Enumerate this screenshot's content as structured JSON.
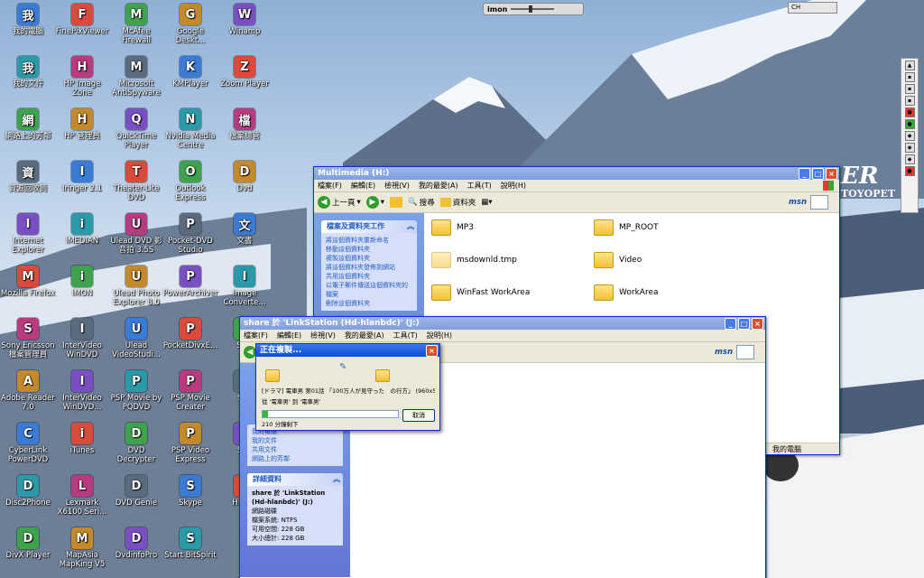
{
  "desktop_icons": [
    [
      "我的電腦",
      "FinePixViewer",
      "McAfee Firewall",
      "Google Deskt...",
      "Winamp"
    ],
    [
      "我的文件",
      "HP Image Zone",
      "Microsoft AntiSpyware",
      "KMPlayer",
      "Zoom Player"
    ],
    [
      "網路上的芳鄰",
      "HP 管理員",
      "QuickTime Player",
      "Nvidia Media Centre",
      "檔案總管"
    ],
    [
      "資源回收筒",
      "Iringer 2.1",
      "Theater-Lite DVD",
      "Outlook Express",
      "Dvd"
    ],
    [
      "Internet Explorer",
      "iMEDIAN",
      "Ulead DVD 影音拍 3.5S",
      "Pocket-DVD Studio",
      "文書"
    ],
    [
      "Mozilla Firefox",
      "iMON",
      "Ulead Photo Explorer 8.0",
      "PowerArchiver",
      "Image Converte..."
    ],
    [
      "Sony Ericsson 檔案管理員",
      "InterVideo WinDVD",
      "Ulead VideoStudi...",
      "PocketDivxE...",
      "Star"
    ],
    [
      "Adobe Reader 7.0",
      "InterVideo WinDVD...",
      "PSP Movie by PQDVD",
      "PSP Movie Creater",
      "Sho"
    ],
    [
      "CyberLink PowerDVD",
      "iTunes",
      "DVD Decrypter",
      "PSP Video Express",
      "Son"
    ],
    [
      "Disc2Phone",
      "Lexmark X6100 Seri...",
      "DVD Genie",
      "Skype",
      "HD-HL"
    ],
    [
      "DivX Player",
      "MapAsia MapKing V5",
      "DvdinfoPro",
      "Start BitSpirit",
      ""
    ]
  ],
  "imon_bar": {
    "label": "imon"
  },
  "lang_bar": {
    "label": "CH"
  },
  "brand_text": {
    "er": "ER",
    "toyopet": "TOYOPET"
  },
  "window_multimedia": {
    "title": "Multimedia (H:)",
    "menu": [
      "檔案(F)",
      "編輯(E)",
      "檢視(V)",
      "我的最愛(A)",
      "工具(T)",
      "說明(H)"
    ],
    "toolbar": {
      "back": "上一頁",
      "search": "搜尋",
      "folders": "資料夾",
      "msn": "msn"
    },
    "task_pane": {
      "header": "檔案及資料夾工作",
      "items": [
        "將這個資料夾重新命名",
        "移動這個資料夾",
        "複製這個資料夾",
        "將這個資料夾發佈到網站",
        "共用這個資料夾",
        "以電子郵件傳送這個資料夾的檔案",
        "刪除這個資料夾"
      ]
    },
    "folders": [
      "MP3",
      "MP_ROOT",
      "msdownld.tmp",
      "Video",
      "WinFast WorkArea",
      "WorkArea"
    ],
    "status": "我的電腦"
  },
  "window_share": {
    "title": "share 於 'LinkStation (Hd-hlanbdc)' (J:)",
    "menu": [
      "檔案(F)",
      "編輯(E)",
      "檢視(V)",
      "我的最愛(A)",
      "工具(T)",
      "說明(H)"
    ],
    "msn": "msn",
    "other_places": [
      "我的電腦",
      "我的文件",
      "共用文件",
      "網路上的芳鄰"
    ],
    "details": {
      "header": "詳細資料",
      "name": "share 於 'LinkStation (Hd-hlanbdc)' (J:)",
      "type": "網路磁碟",
      "filesystem": "檔案系統: NTFS",
      "free": "可用空間: 228 GB",
      "total": "大小總計: 228 GB"
    }
  },
  "copy_dialog": {
    "title": "正在複製...",
    "file": "[ドラマ] 電車男 第01話 「100万人が見守った　の行方」 (960x54...",
    "from_to": "從 '電車男' 到 '電車男'",
    "remaining": "210 分鐘剩下",
    "cancel": "取消",
    "progress": 0.04
  },
  "colors": {
    "title_active": "#0a4fd8",
    "title_inactive": "#8aa8e2",
    "task_pane": "#6f8ee0",
    "dialog_bg": "#ece9d8",
    "progress": "#2fbd2f"
  }
}
